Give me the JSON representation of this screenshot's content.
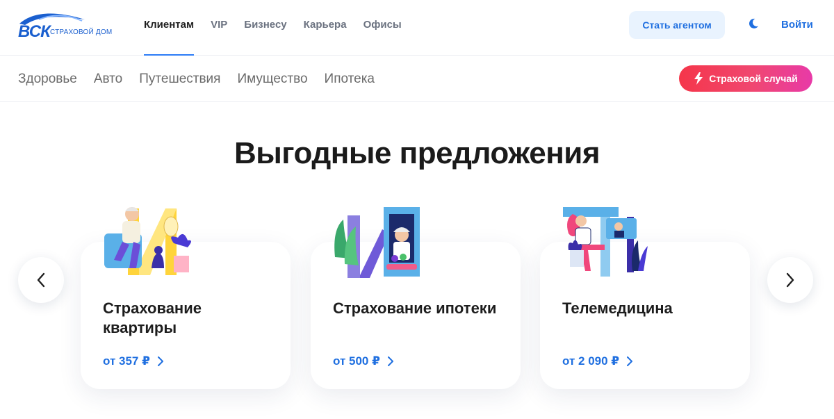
{
  "header": {
    "logo_text": "ВСК",
    "logo_sub": "СТРАХОВОЙ ДОМ",
    "nav": [
      {
        "label": "Клиентам",
        "active": true
      },
      {
        "label": "VIP",
        "active": false
      },
      {
        "label": "Бизнесу",
        "active": false
      },
      {
        "label": "Карьера",
        "active": false
      },
      {
        "label": "Офисы",
        "active": false
      }
    ],
    "agent_button": "Стать агентом",
    "theme_icon": "moon-icon",
    "login_label": "Войти"
  },
  "subnav": {
    "items": [
      "Здоровье",
      "Авто",
      "Путешествия",
      "Имущество",
      "Ипотека"
    ],
    "claim_button": "Страховой случай",
    "claim_icon": "lightning-icon"
  },
  "main": {
    "heading": "Выгодные предложения",
    "cards": [
      {
        "title": "Страхование квартиры",
        "price": "от 357 ₽",
        "illustration": "man-with-cat-illustration"
      },
      {
        "title": "Страхование ипотеки",
        "price": "от 500 ₽",
        "illustration": "woman-in-window-illustration"
      },
      {
        "title": "Телемедицина",
        "price": "от 2 090 ₽",
        "illustration": "video-call-doctor-illustration"
      }
    ],
    "prev_icon": "chevron-left-icon",
    "next_icon": "chevron-right-icon"
  },
  "colors": {
    "accent": "#1f6fe0",
    "nav_underline": "#2d7cf6",
    "agent_bg": "#e9f3fe",
    "claim_gradient": [
      "#f5364a",
      "#e83aa8"
    ]
  }
}
